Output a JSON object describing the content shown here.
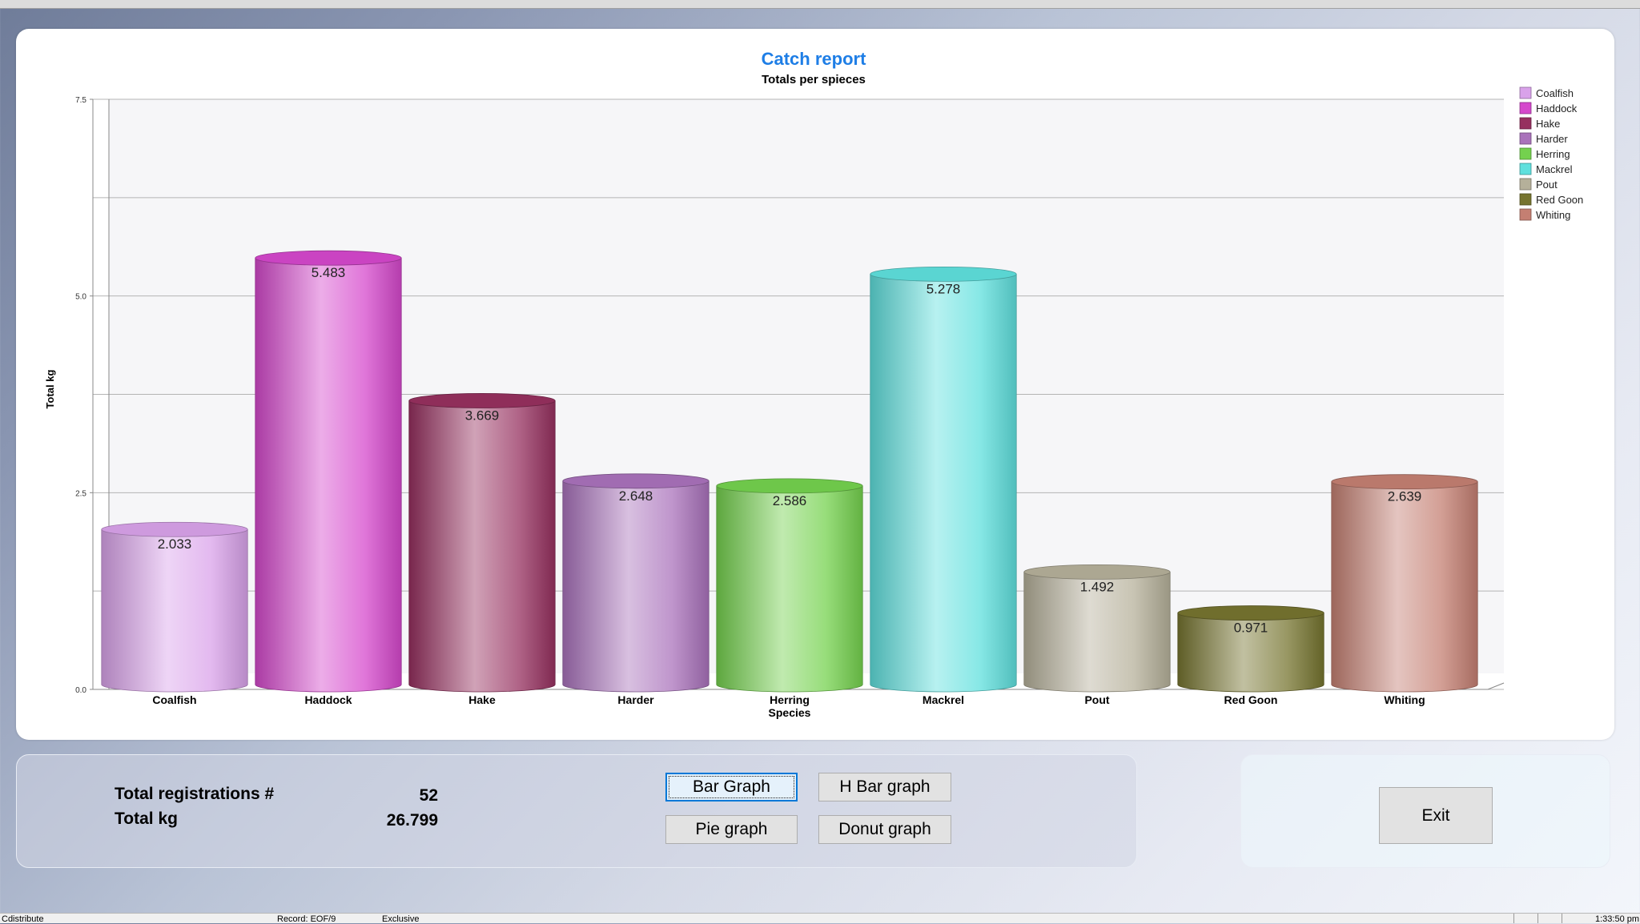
{
  "chart_data": {
    "type": "bar",
    "title": "Catch report",
    "subtitle": "Totals per spieces",
    "xlabel": "Species",
    "ylabel": "Total kg",
    "ylim": [
      0,
      7.5
    ],
    "yticks": [
      "0.0",
      "2.5",
      "5.0",
      "7.5"
    ],
    "categories": [
      "Coalfish",
      "Haddock",
      "Hake",
      "Harder",
      "Herring",
      "Mackrel",
      "Pout",
      "Red Goon",
      "Whiting"
    ],
    "values": [
      2.033,
      5.483,
      3.669,
      2.648,
      2.586,
      5.278,
      1.492,
      0.971,
      2.639
    ],
    "value_labels": [
      "2.033",
      "5.483",
      "3.669",
      "2.648",
      "2.586",
      "5.278",
      "1.492",
      "0.971",
      "2.639"
    ],
    "colors": [
      "#d9a2ea",
      "#d548cc",
      "#96305f",
      "#a972bb",
      "#74d14e",
      "#5fe0dd",
      "#b5b09a",
      "#76742f",
      "#c47f72"
    ],
    "legend_position": "right",
    "grid": true
  },
  "stats": {
    "registrations_label": "Total registrations #",
    "registrations_value": "52",
    "kg_label": "Total kg",
    "kg_value": "26.799"
  },
  "buttons": {
    "bar_graph": "Bar Graph",
    "hbar_graph": "H Bar graph",
    "pie_graph": "Pie graph",
    "donut_graph": "Donut graph",
    "exit": "Exit"
  },
  "statusbar": {
    "left": "Cdistribute",
    "record": "Record: EOF/9",
    "mode": "Exclusive",
    "time": "1:33:50 pm"
  }
}
